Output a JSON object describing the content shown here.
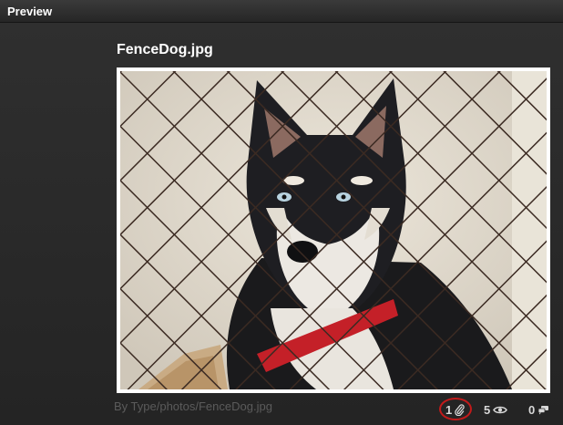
{
  "panel": {
    "title": "Preview"
  },
  "file": {
    "name": "FenceDog.jpg",
    "path": "By Type/photos/FenceDog.jpg"
  },
  "stats": {
    "attachments": "1",
    "views": "5",
    "comments": "0"
  },
  "icons": {
    "attachments": "paperclip-icon",
    "views": "eye-icon",
    "comments": "speech-bubble-icon"
  },
  "colors": {
    "highlight_ring": "#c21a1a",
    "collar": "#c42028"
  }
}
